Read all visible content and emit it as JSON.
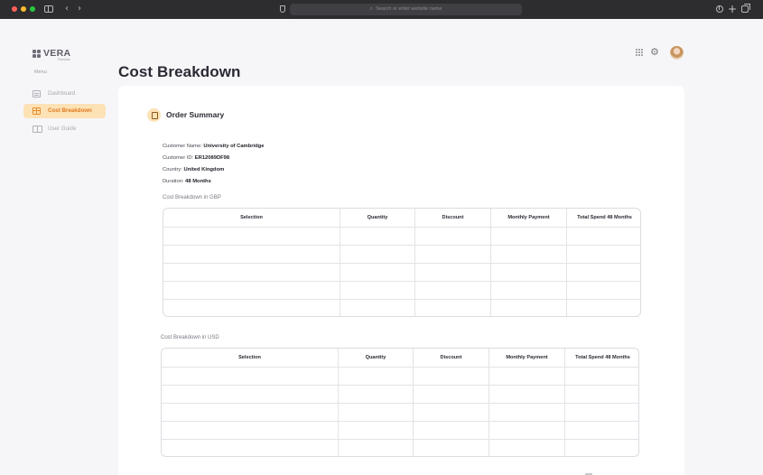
{
  "browser": {
    "url_placeholder": "Search or enter website name",
    "back_glyph": "‹",
    "forward_glyph": "›",
    "new_tab_glyph": "+"
  },
  "app": {
    "logo_text": "VERA",
    "logo_subtext": "Rentals",
    "menu_label": "Menu",
    "nav": [
      {
        "label": "Dashboard",
        "icon": "dashboard-icon",
        "active": false
      },
      {
        "label": "Cost Breakdown",
        "icon": "table-icon",
        "active": true
      },
      {
        "label": "User Guide",
        "icon": "book-icon",
        "active": false
      }
    ],
    "page_title": "Cost Breakdown",
    "header_icons": [
      "apps-grid-icon",
      "gear-icon",
      "user-avatar"
    ],
    "accent_color": "#e07b20",
    "accent_bg": "#fde2b6"
  },
  "summary": {
    "title": "Order Summary",
    "fields": [
      {
        "label": "Customer Name: ",
        "value": "University of Cambridge"
      },
      {
        "label": "Customer ID: ",
        "value": "ER12089DF98"
      },
      {
        "label": "Country: ",
        "value": "United Kingdom"
      },
      {
        "label": "Duration: ",
        "value": "48 Months"
      }
    ]
  },
  "tables": [
    {
      "caption": "Cost Breakdown in GBP",
      "headers": [
        "Selection",
        "Quantity",
        "Discount",
        "Monthly Payment",
        "Total Spend 48 Months"
      ],
      "rows": [
        [
          "",
          "",
          "",
          "",
          ""
        ],
        [
          "",
          "",
          "",
          "",
          ""
        ],
        [
          "",
          "",
          "",
          "",
          ""
        ],
        [
          "",
          "",
          "",
          "",
          ""
        ],
        [
          "",
          "",
          "",
          "",
          ""
        ]
      ]
    },
    {
      "caption": "Cost Breakdown in USD",
      "headers": [
        "Selection",
        "Quantity",
        "Discount",
        "Monthly Payment",
        "Total Spend 48 Months"
      ],
      "rows": [
        [
          "",
          "",
          "",
          "",
          ""
        ],
        [
          "",
          "",
          "",
          "",
          ""
        ],
        [
          "",
          "",
          "",
          "",
          ""
        ],
        [
          "",
          "",
          "",
          "",
          ""
        ],
        [
          "",
          "",
          "",
          "",
          ""
        ]
      ]
    }
  ]
}
